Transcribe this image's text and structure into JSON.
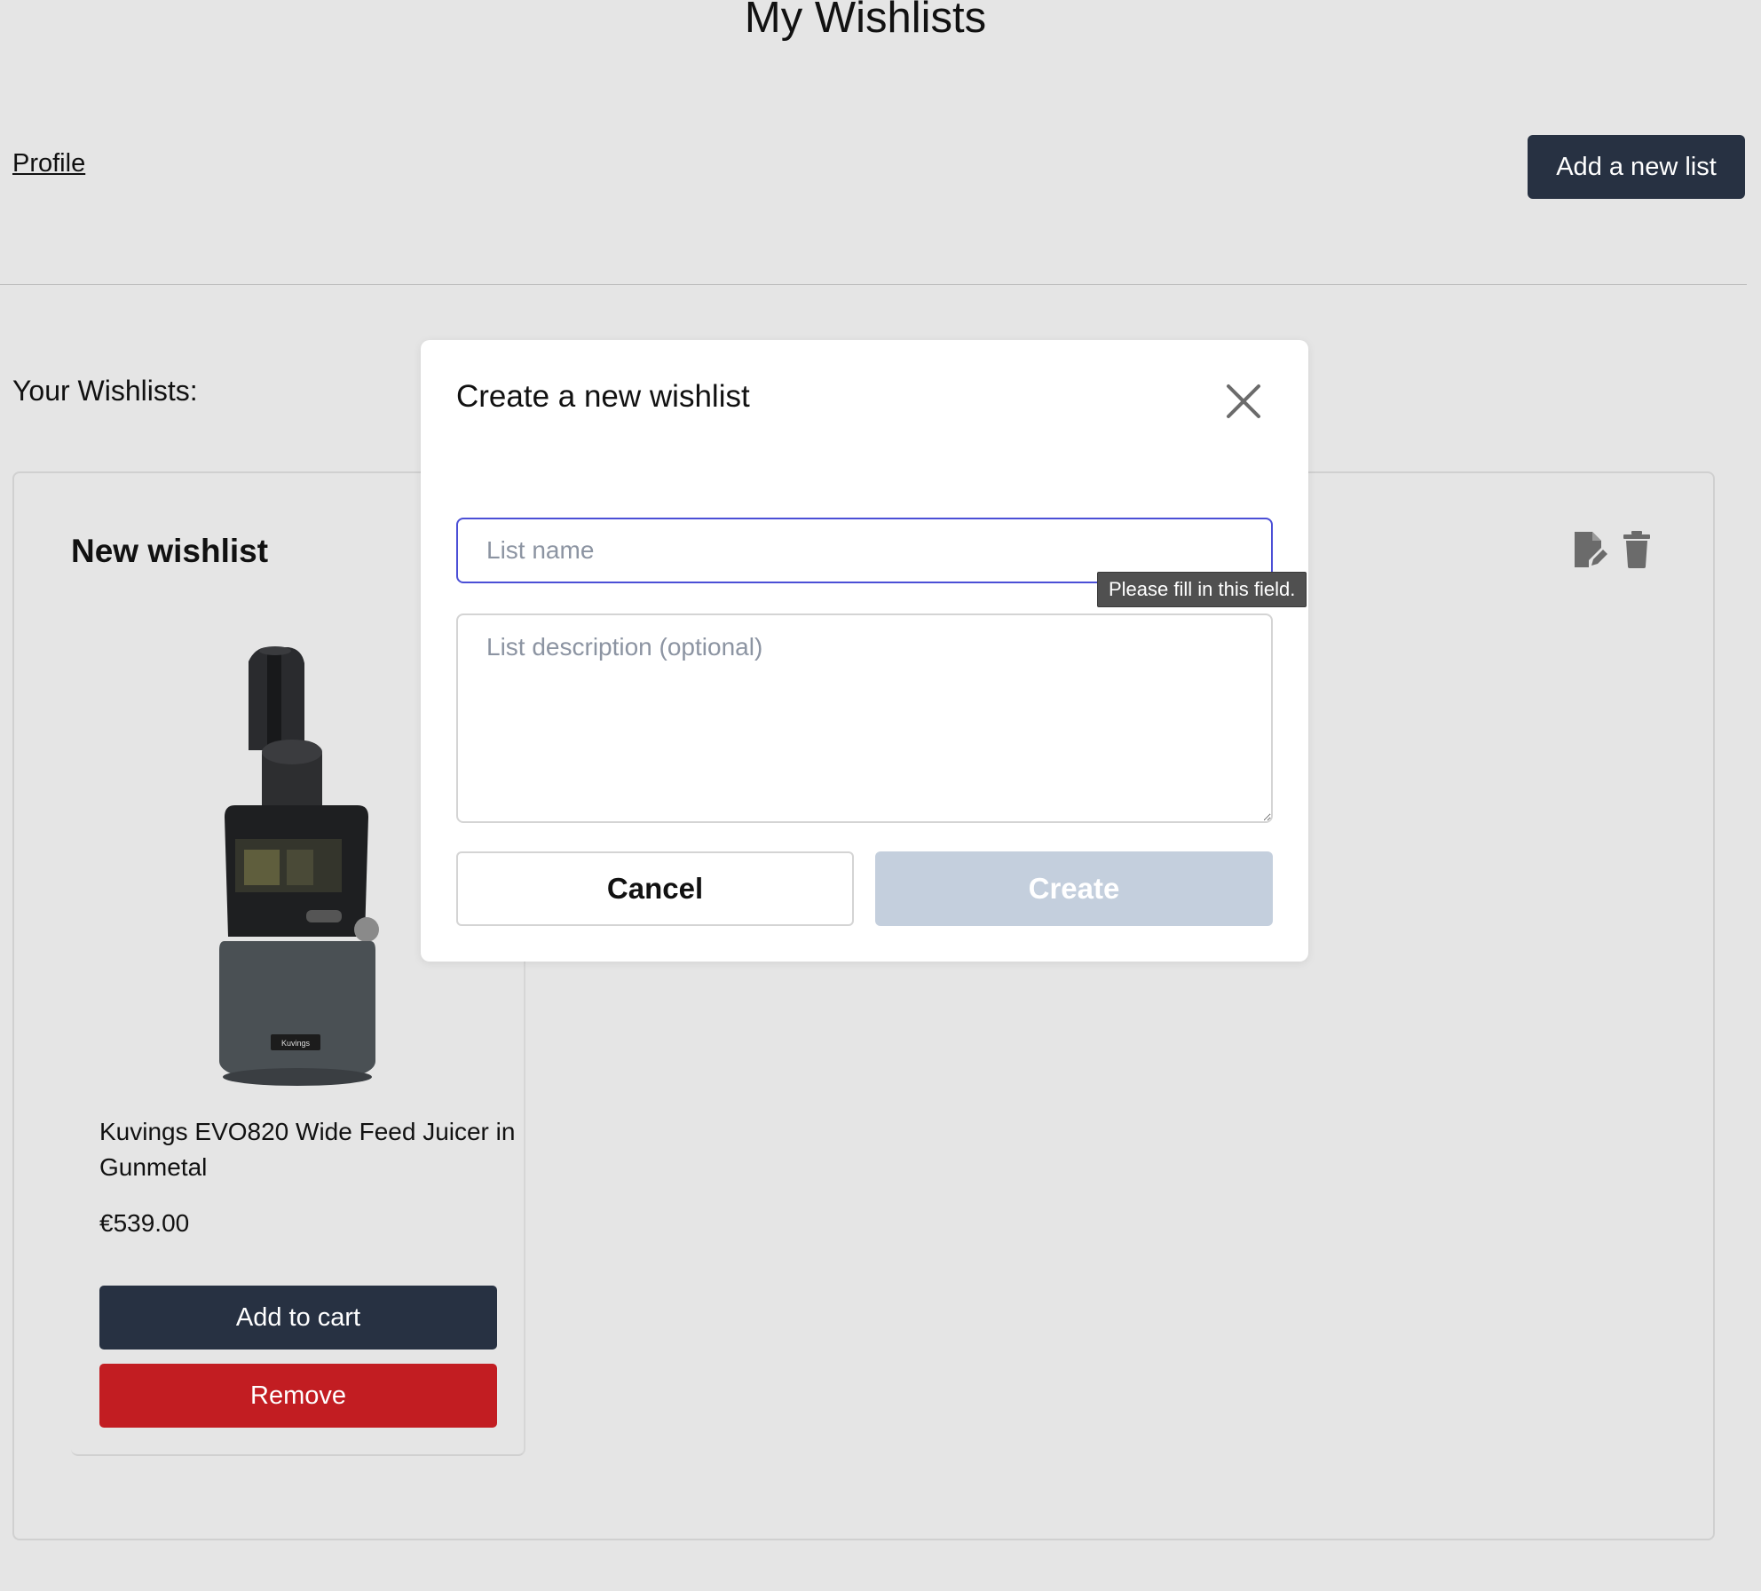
{
  "page": {
    "title": "My Wishlists",
    "profile_link": "Profile",
    "add_list_button": "Add a new list",
    "wishlists_heading": "Your Wishlists:"
  },
  "wishlist": {
    "name": "New wishlist",
    "product": {
      "name": "Kuvings EVO820 Wide Feed Juicer in Gunmetal",
      "price": "€539.00",
      "image_brand": "Kuvings",
      "add_to_cart": "Add to cart",
      "remove": "Remove"
    }
  },
  "modal": {
    "title": "Create a new wishlist",
    "name_placeholder": "List name",
    "name_value": "",
    "description_placeholder": "List description (optional)",
    "cancel": "Cancel",
    "create": "Create",
    "validation_tooltip": "Please fill in this field."
  },
  "icons": {
    "edit": "edit-document-icon",
    "delete": "trash-icon",
    "close": "close-icon"
  },
  "colors": {
    "primary_dark": "#273142",
    "danger": "#c21d22",
    "disabled_button": "#c4cfdd",
    "focus_border": "#4b4fd6",
    "background": "#e5e5e5"
  }
}
